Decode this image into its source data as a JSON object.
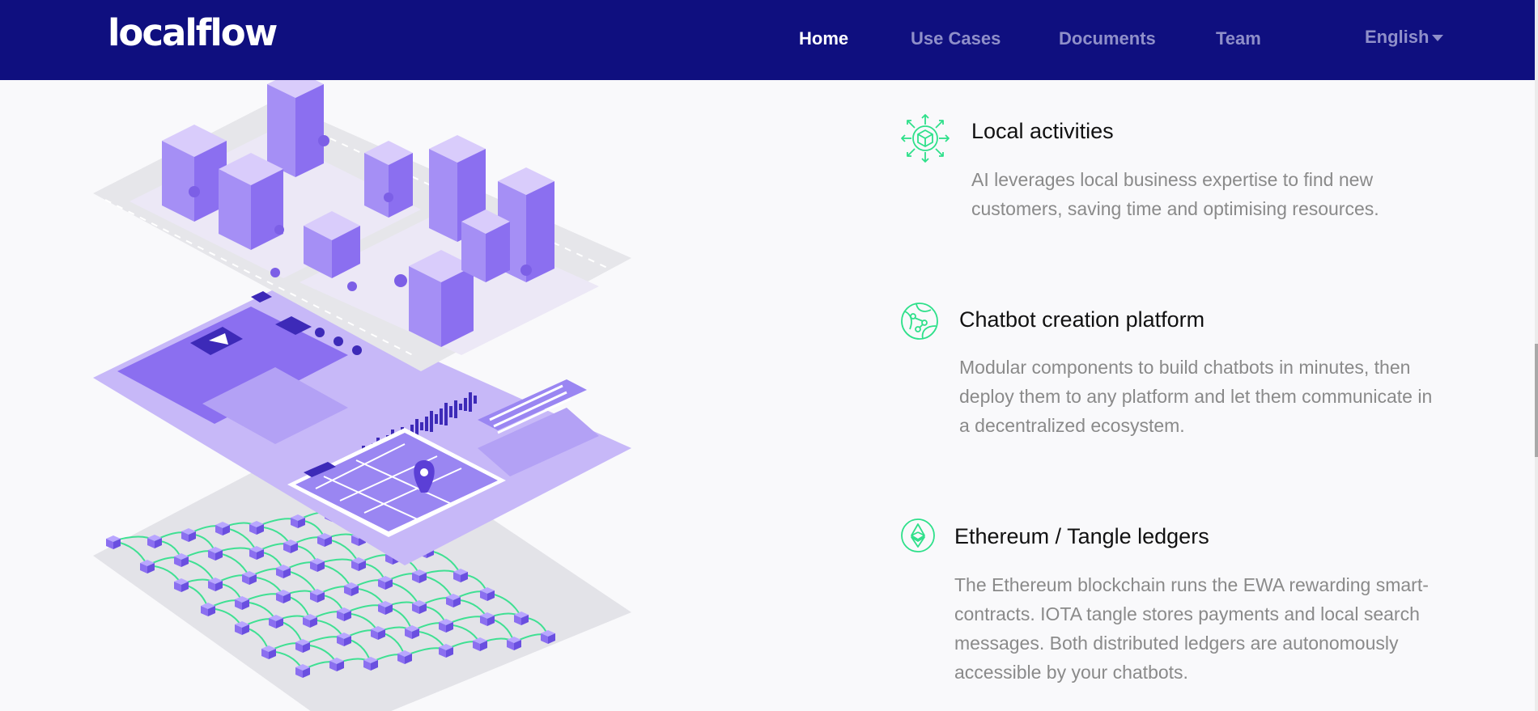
{
  "brand": {
    "logo_text": "localflow"
  },
  "nav": {
    "links": [
      {
        "label": "Home",
        "active": true
      },
      {
        "label": "Use Cases",
        "active": false
      },
      {
        "label": "Documents",
        "active": false
      },
      {
        "label": "Team",
        "active": false
      }
    ],
    "language": "English"
  },
  "colors": {
    "navbar_bg": "#0f0f7f",
    "nav_active": "#ffffff",
    "nav_inactive": "#8f8fc9",
    "accent_green": "#2ee08a",
    "illustration_purple": "#8b6ff0",
    "illustration_light": "#c3b4f7",
    "page_bg": "#f9f9fb"
  },
  "features": [
    {
      "icon": "cube-arrows-icon",
      "title": "Local activities",
      "description": "AI leverages local business expertise to find new customers, saving time and optimising resources."
    },
    {
      "icon": "network-globe-icon",
      "title": "Chatbot creation platform",
      "description": "Modular components to build chatbots in minutes, then deploy them to any platform and let them communicate in a decentralized ecosystem."
    },
    {
      "icon": "ethereum-icon",
      "title": "Ethereum / Tangle ledgers",
      "description": "The Ethereum blockchain runs the EWA rewarding smart-contracts. IOTA tangle stores payments and local search messages. Both distributed ledgers are autonomously accessible by your chatbots."
    }
  ]
}
